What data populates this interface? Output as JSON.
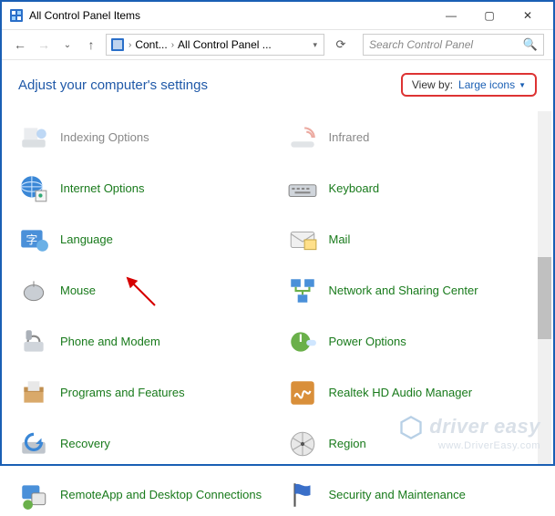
{
  "window": {
    "title": "All Control Panel Items",
    "minimize": "—",
    "maximize": "▢",
    "close": "✕"
  },
  "toolbar": {
    "back": "←",
    "forward": "→",
    "recent": "⌄",
    "up": "↑",
    "breadcrumb": {
      "seg1": "Cont...",
      "seg2": "All Control Panel ..."
    },
    "refresh": "⟳",
    "search_placeholder": "Search Control Panel",
    "search_icon": "🔍"
  },
  "header": {
    "heading": "Adjust your computer's settings",
    "viewby_label": "View by:",
    "viewby_value": "Large icons"
  },
  "items_left": [
    {
      "label": "Indexing Options",
      "icon": "index"
    },
    {
      "label": "Internet Options",
      "icon": "globe"
    },
    {
      "label": "Language",
      "icon": "lang"
    },
    {
      "label": "Mouse",
      "icon": "mouse"
    },
    {
      "label": "Phone and Modem",
      "icon": "phone"
    },
    {
      "label": "Programs and Features",
      "icon": "box"
    },
    {
      "label": "Recovery",
      "icon": "recovery"
    },
    {
      "label": "RemoteApp and Desktop Connections",
      "icon": "remote"
    }
  ],
  "items_right": [
    {
      "label": "Infrared",
      "icon": "ir"
    },
    {
      "label": "Keyboard",
      "icon": "keyboard"
    },
    {
      "label": "Mail",
      "icon": "mail"
    },
    {
      "label": "Network and Sharing Center",
      "icon": "network"
    },
    {
      "label": "Power Options",
      "icon": "power"
    },
    {
      "label": "Realtek HD Audio Manager",
      "icon": "audio"
    },
    {
      "label": "Region",
      "icon": "region"
    },
    {
      "label": "Security and Maintenance",
      "icon": "flag"
    }
  ],
  "watermark": {
    "main": "driver easy",
    "sub": "www.DriverEasy.com"
  }
}
